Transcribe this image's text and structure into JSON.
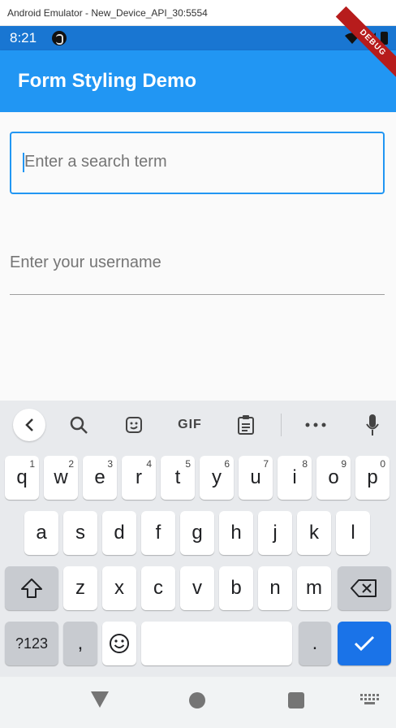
{
  "window": {
    "title": "Android Emulator - New_Device_API_30:5554"
  },
  "status_bar": {
    "time": "8:21"
  },
  "app_bar": {
    "title": "Form Styling Demo"
  },
  "debug_banner": "DEBUG",
  "form": {
    "search_placeholder": "Enter a search term",
    "username_placeholder": "Enter your username"
  },
  "keyboard": {
    "toolbar": {
      "gif_label": "GIF"
    },
    "row1": [
      {
        "label": "q",
        "hint": "1"
      },
      {
        "label": "w",
        "hint": "2"
      },
      {
        "label": "e",
        "hint": "3"
      },
      {
        "label": "r",
        "hint": "4"
      },
      {
        "label": "t",
        "hint": "5"
      },
      {
        "label": "y",
        "hint": "6"
      },
      {
        "label": "u",
        "hint": "7"
      },
      {
        "label": "i",
        "hint": "8"
      },
      {
        "label": "o",
        "hint": "9"
      },
      {
        "label": "p",
        "hint": "0"
      }
    ],
    "row2": [
      "a",
      "s",
      "d",
      "f",
      "g",
      "h",
      "j",
      "k",
      "l"
    ],
    "row3": [
      "z",
      "x",
      "c",
      "v",
      "b",
      "n",
      "m"
    ],
    "bottom": {
      "symbols": "?123",
      "comma": ",",
      "period": "."
    }
  },
  "colors": {
    "primary": "#2196F3",
    "status_bar": "#1976D2",
    "keyboard_bg": "#E8EAED",
    "enter_key": "#1A73E8"
  }
}
